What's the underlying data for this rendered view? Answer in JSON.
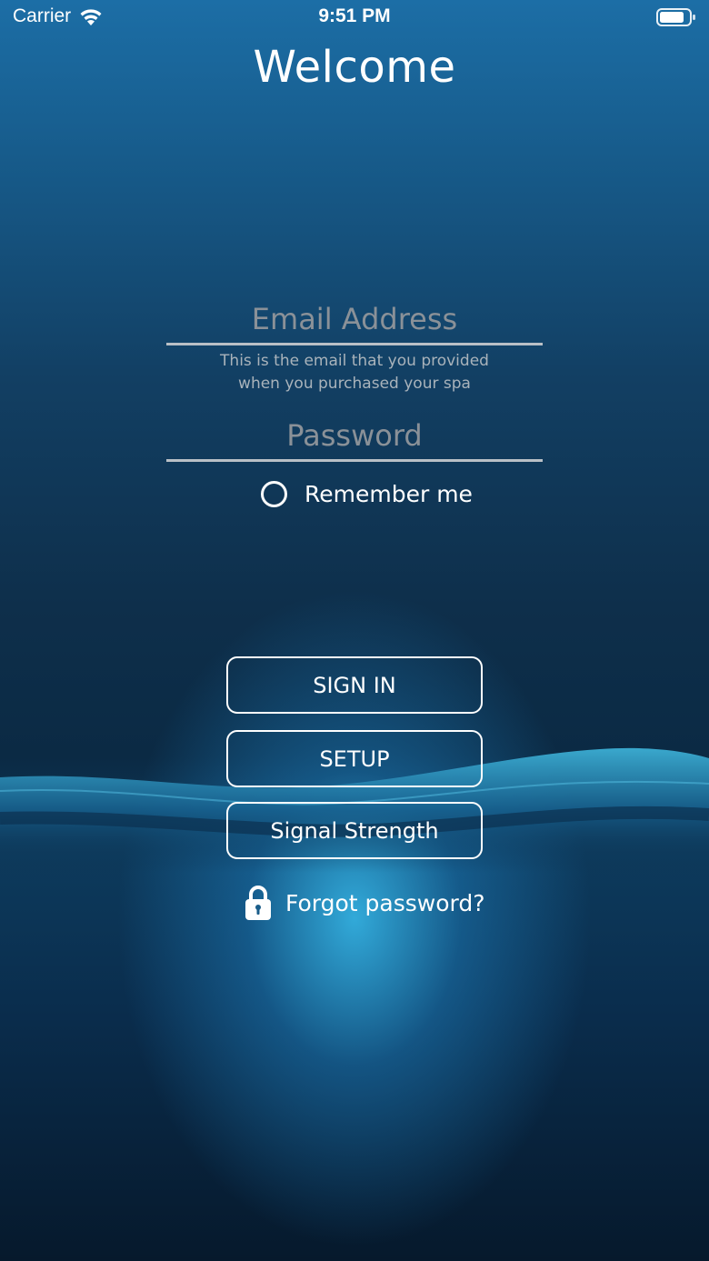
{
  "status_bar": {
    "carrier": "Carrier",
    "time": "9:51 PM"
  },
  "title": "Welcome",
  "email": {
    "placeholder": "Email Address",
    "value": "",
    "helper_line1": "This is the email that you provided",
    "helper_line2": "when you purchased your spa"
  },
  "password": {
    "placeholder": "Password",
    "value": ""
  },
  "remember": {
    "label": "Remember me",
    "checked": false
  },
  "buttons": {
    "sign_in": "SIGN IN",
    "setup": "SETUP",
    "signal_strength": "Signal Strength"
  },
  "forgot_password": "Forgot password?",
  "icons": {
    "wifi": "wifi-icon",
    "battery": "battery-icon",
    "lock": "lock-icon"
  },
  "colors": {
    "text": "#ffffff",
    "placeholder": "#8a9198",
    "underline": "#b9c0c6",
    "accent_glow": "#34b0e0"
  }
}
